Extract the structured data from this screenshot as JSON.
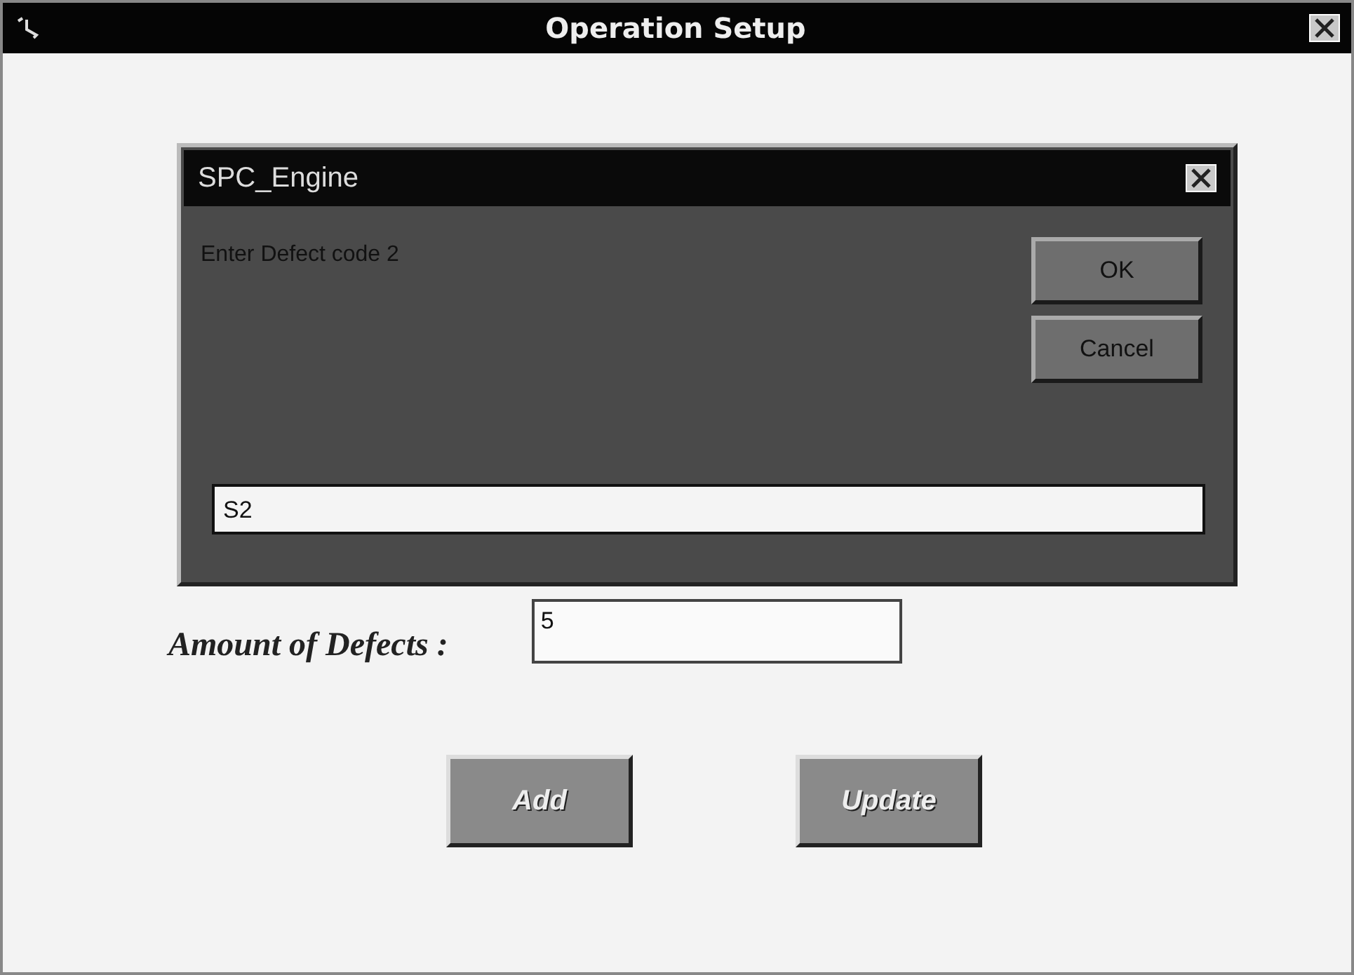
{
  "window": {
    "title": "Operation Setup"
  },
  "form": {
    "fields": [
      {
        "label": "Amount of Defects :",
        "value": "5"
      }
    ],
    "buttons": [
      "Add",
      "Update"
    ]
  },
  "dialog": {
    "title": "SPC_Engine",
    "prompt": "Enter Defect code  2",
    "value": "S2",
    "buttons": [
      "OK",
      "Cancel"
    ]
  }
}
